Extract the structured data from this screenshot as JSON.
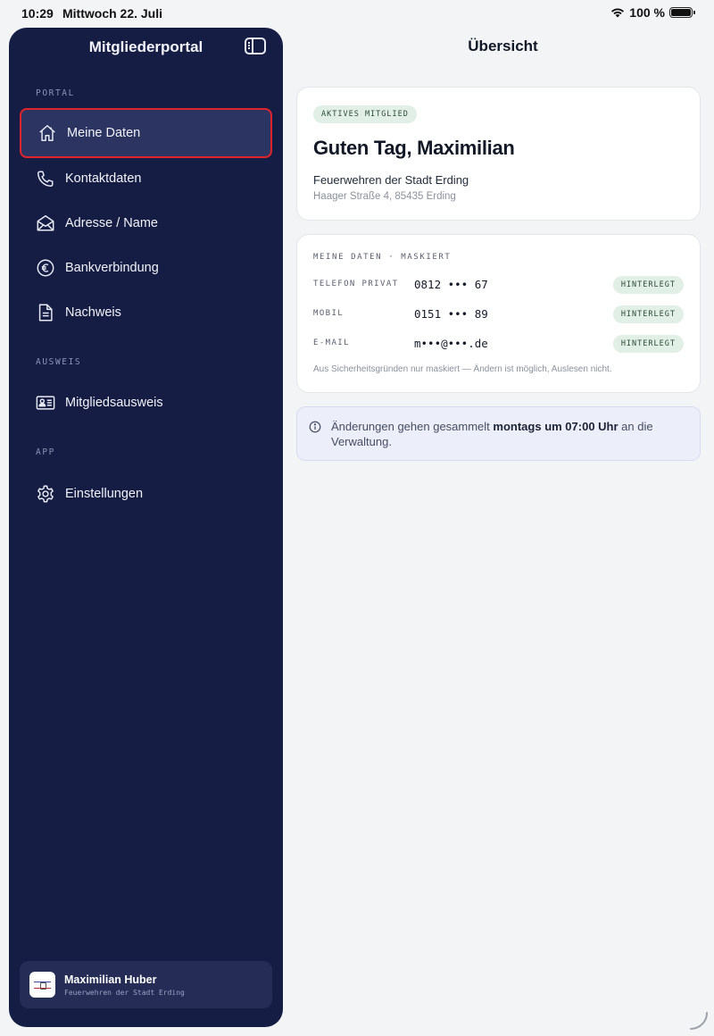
{
  "status_bar": {
    "time": "10:29",
    "date": "Mittwoch 22. Juli",
    "battery": "100 %"
  },
  "sidebar": {
    "title": "Mitgliederportal",
    "sections": {
      "portal": "PORTAL",
      "ausweis": "AUSWEIS",
      "app": "APP"
    },
    "items": [
      {
        "label": "Meine Daten",
        "icon": "house-icon"
      },
      {
        "label": "Kontaktdaten",
        "icon": "phone-icon"
      },
      {
        "label": "Adresse / Name",
        "icon": "envelope-icon"
      },
      {
        "label": "Bankverbindung",
        "icon": "euro-icon"
      },
      {
        "label": "Nachweis",
        "icon": "document-icon"
      },
      {
        "label": "Mitgliedsausweis",
        "icon": "id-card-icon"
      },
      {
        "label": "Einstellungen",
        "icon": "gear-icon"
      }
    ],
    "active_item": "Meine Daten",
    "profile": {
      "name": "Maximilian Huber",
      "org": "Feuerwehren der Stadt Erding"
    }
  },
  "main": {
    "title": "Übersicht",
    "member_card": {
      "badge": "AKTIVES MITGLIED",
      "greeting": "Guten Tag, Maximilian",
      "org": "Feuerwehren der Stadt Erding",
      "address": "Haager Straße 4, 85435 Erding"
    },
    "data_card": {
      "heading": "MEINE DATEN · MASKIERT",
      "rows": [
        {
          "key": "TELEFON PRIVAT",
          "value": "0812 ••• 67",
          "status": "HINTERLEGT"
        },
        {
          "key": "MOBIL",
          "value": "0151 ••• 89",
          "status": "HINTERLEGT"
        },
        {
          "key": "E-MAIL",
          "value": "m•••@•••.de",
          "status": "HINTERLEGT"
        }
      ],
      "note": "Aus Sicherheitsgründen nur maskiert — Ändern ist möglich, Auslesen nicht."
    },
    "info": {
      "text_before": "Änderungen gehen gesammelt ",
      "text_bold": "montags um 07:00 Uhr",
      "text_after": " an die Verwaltung."
    }
  },
  "colors": {
    "sidebar_bg": "#161d45",
    "active_item_bg": "#2c3562",
    "active_item_border": "#e0242b",
    "badge_bg": "#e1efe6",
    "page_bg": "#f3f4f6"
  }
}
